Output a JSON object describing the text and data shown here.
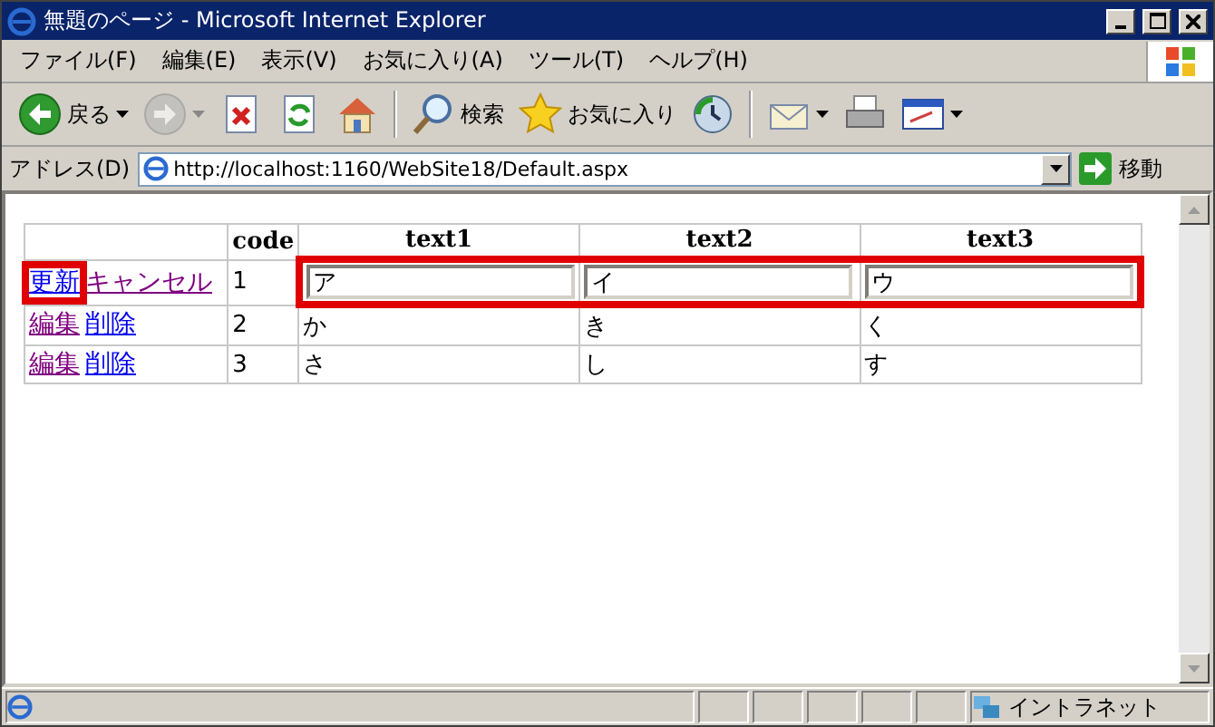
{
  "window": {
    "title": "無題のページ - Microsoft Internet Explorer"
  },
  "menu": [
    "ファイル(F)",
    "編集(E)",
    "表示(V)",
    "お気に入り(A)",
    "ツール(T)",
    "ヘルプ(H)"
  ],
  "toolbar": [
    {
      "kind": "back",
      "label": "戻る",
      "disabled": false
    },
    {
      "kind": "forward",
      "disabled": true
    },
    {
      "kind": "stop"
    },
    {
      "kind": "refresh"
    },
    {
      "kind": "home"
    },
    {
      "kind": "search",
      "label": "検索"
    },
    {
      "kind": "favorites",
      "label": "お気に入り"
    },
    {
      "kind": "history"
    },
    {
      "kind": "mail"
    },
    {
      "kind": "print"
    },
    {
      "kind": "edit"
    }
  ],
  "address": {
    "label": "アドレス(D)",
    "url": "http://localhost:1160/WebSite18/Default.aspx",
    "go": "移動"
  },
  "table": {
    "columns": [
      "code",
      "text1",
      "text2",
      "text3"
    ],
    "rows": [
      {
        "kind": "edit",
        "links": [
          {
            "label": "更新",
            "visited": false,
            "highlighted": true
          },
          {
            "label": "キャンセル",
            "visited": true,
            "highlighted": false
          }
        ],
        "code": "1",
        "values": [
          "ア",
          "イ",
          "ウ"
        ],
        "highlighted": true
      },
      {
        "kind": "view",
        "links": [
          {
            "label": "編集",
            "visited": true,
            "highlighted": false
          },
          {
            "label": "削除",
            "visited": false,
            "highlighted": false
          }
        ],
        "code": "2",
        "values": [
          "か",
          "き",
          "く"
        ],
        "highlighted": false
      },
      {
        "kind": "view",
        "links": [
          {
            "label": "編集",
            "visited": true,
            "highlighted": false
          },
          {
            "label": "削除",
            "visited": false,
            "highlighted": false
          }
        ],
        "code": "3",
        "values": [
          "さ",
          "し",
          "す"
        ],
        "highlighted": false
      }
    ]
  },
  "status_bar": {
    "zone": "イントラネット"
  }
}
